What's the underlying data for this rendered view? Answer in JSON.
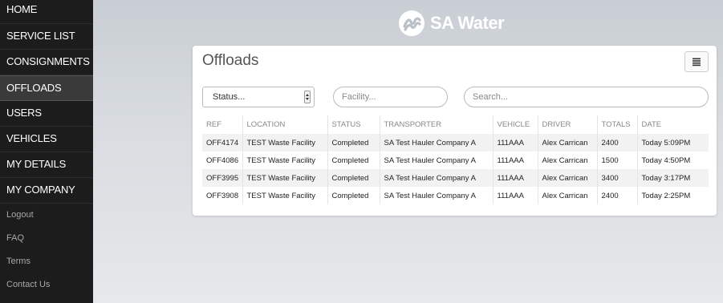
{
  "sidebar": {
    "items": [
      {
        "label": "HOME"
      },
      {
        "label": "SERVICE LIST"
      },
      {
        "label": "CONSIGNMENTS"
      },
      {
        "label": "OFFLOADS"
      },
      {
        "label": "USERS"
      },
      {
        "label": "VEHICLES"
      },
      {
        "label": "MY DETAILS"
      },
      {
        "label": "MY COMPANY"
      }
    ],
    "active": "OFFLOADS",
    "links": [
      {
        "label": "Logout"
      },
      {
        "label": "FAQ"
      },
      {
        "label": "Terms"
      },
      {
        "label": "Contact Us"
      }
    ]
  },
  "header": {
    "brand": "SA Water"
  },
  "main": {
    "title": "Offloads",
    "filters": {
      "status_value": "Status...",
      "facility_placeholder": "Facility...",
      "search_placeholder": "Search..."
    },
    "table": {
      "columns": [
        "REF",
        "LOCATION",
        "STATUS",
        "TRANSPORTER",
        "VEHICLE",
        "DRIVER",
        "TOTALS",
        "DATE"
      ],
      "rows": [
        [
          "OFF4174",
          "TEST Waste Facility",
          "Completed",
          "SA Test Hauler Company A",
          "111AAA",
          "Alex Carrican",
          "2400",
          "Today 5:09PM"
        ],
        [
          "OFF4086",
          "TEST Waste Facility",
          "Completed",
          "SA Test Hauler Company A",
          "111AAA",
          "Alex Carrican",
          "1500",
          "Today 4:50PM"
        ],
        [
          "OFF3995",
          "TEST Waste Facility",
          "Completed",
          "SA Test Hauler Company A",
          "111AAA",
          "Alex Carrican",
          "3400",
          "Today 3:17PM"
        ],
        [
          "OFF3908",
          "TEST Waste Facility",
          "Completed",
          "SA Test Hauler Company A",
          "111AAA",
          "Alex Carrican",
          "2400",
          "Today 2:25PM"
        ]
      ]
    }
  },
  "colors": {
    "sidebar_bg": "#1c1c1c",
    "active_bg": "#3a3a3a",
    "brand_text": "#ffffff"
  },
  "icons": {
    "logo": "sa-water-logo-icon",
    "menu": "hamburger-menu-icon",
    "select_arrow": "select-arrow-icon"
  }
}
